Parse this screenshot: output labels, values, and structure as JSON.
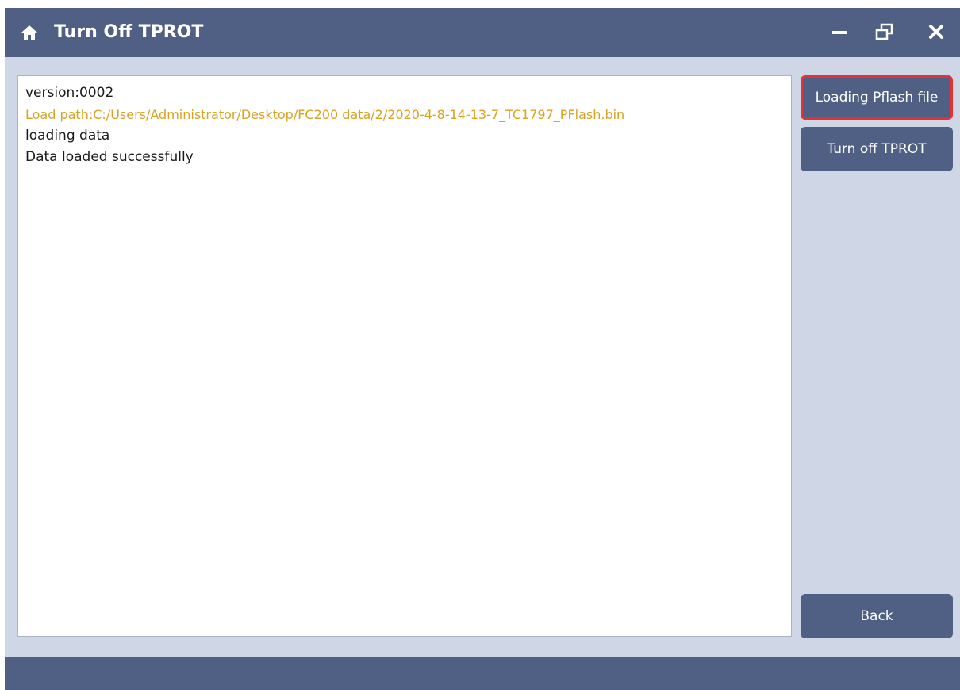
{
  "window": {
    "title": "Turn Off TPROT",
    "colors": {
      "titlebar": "#4f6084",
      "background": "#cfd7e6",
      "highlight_border": "#e03238",
      "path_text": "#d9a21f"
    },
    "controls": {
      "minimize_icon": "minus-icon",
      "restore_icon": "restore-window-icon",
      "close_icon": "close-icon"
    }
  },
  "log": {
    "lines": [
      "version:0002",
      "Load path:C:/Users/Administrator/Desktop/FC200 data/2/2020-4-8-14-13-7_TC1797_PFlash.bin",
      "loading data",
      "Data loaded successfully"
    ]
  },
  "actions": {
    "load_pflash_label": "Loading Pflash file",
    "turn_off_tprot_label": "Turn off TPROT",
    "back_label": "Back"
  }
}
